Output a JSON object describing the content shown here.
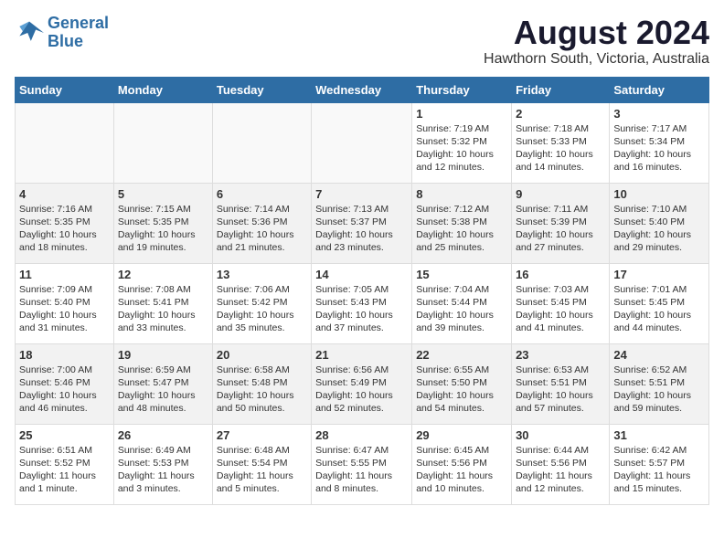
{
  "logo": {
    "line1": "General",
    "line2": "Blue"
  },
  "title": "August 2024",
  "location": "Hawthorn South, Victoria, Australia",
  "days_header": [
    "Sunday",
    "Monday",
    "Tuesday",
    "Wednesday",
    "Thursday",
    "Friday",
    "Saturday"
  ],
  "weeks": [
    [
      {
        "day": "",
        "info": ""
      },
      {
        "day": "",
        "info": ""
      },
      {
        "day": "",
        "info": ""
      },
      {
        "day": "",
        "info": ""
      },
      {
        "day": "1",
        "info": "Sunrise: 7:19 AM\nSunset: 5:32 PM\nDaylight: 10 hours\nand 12 minutes."
      },
      {
        "day": "2",
        "info": "Sunrise: 7:18 AM\nSunset: 5:33 PM\nDaylight: 10 hours\nand 14 minutes."
      },
      {
        "day": "3",
        "info": "Sunrise: 7:17 AM\nSunset: 5:34 PM\nDaylight: 10 hours\nand 16 minutes."
      }
    ],
    [
      {
        "day": "4",
        "info": "Sunrise: 7:16 AM\nSunset: 5:35 PM\nDaylight: 10 hours\nand 18 minutes."
      },
      {
        "day": "5",
        "info": "Sunrise: 7:15 AM\nSunset: 5:35 PM\nDaylight: 10 hours\nand 19 minutes."
      },
      {
        "day": "6",
        "info": "Sunrise: 7:14 AM\nSunset: 5:36 PM\nDaylight: 10 hours\nand 21 minutes."
      },
      {
        "day": "7",
        "info": "Sunrise: 7:13 AM\nSunset: 5:37 PM\nDaylight: 10 hours\nand 23 minutes."
      },
      {
        "day": "8",
        "info": "Sunrise: 7:12 AM\nSunset: 5:38 PM\nDaylight: 10 hours\nand 25 minutes."
      },
      {
        "day": "9",
        "info": "Sunrise: 7:11 AM\nSunset: 5:39 PM\nDaylight: 10 hours\nand 27 minutes."
      },
      {
        "day": "10",
        "info": "Sunrise: 7:10 AM\nSunset: 5:40 PM\nDaylight: 10 hours\nand 29 minutes."
      }
    ],
    [
      {
        "day": "11",
        "info": "Sunrise: 7:09 AM\nSunset: 5:40 PM\nDaylight: 10 hours\nand 31 minutes."
      },
      {
        "day": "12",
        "info": "Sunrise: 7:08 AM\nSunset: 5:41 PM\nDaylight: 10 hours\nand 33 minutes."
      },
      {
        "day": "13",
        "info": "Sunrise: 7:06 AM\nSunset: 5:42 PM\nDaylight: 10 hours\nand 35 minutes."
      },
      {
        "day": "14",
        "info": "Sunrise: 7:05 AM\nSunset: 5:43 PM\nDaylight: 10 hours\nand 37 minutes."
      },
      {
        "day": "15",
        "info": "Sunrise: 7:04 AM\nSunset: 5:44 PM\nDaylight: 10 hours\nand 39 minutes."
      },
      {
        "day": "16",
        "info": "Sunrise: 7:03 AM\nSunset: 5:45 PM\nDaylight: 10 hours\nand 41 minutes."
      },
      {
        "day": "17",
        "info": "Sunrise: 7:01 AM\nSunset: 5:45 PM\nDaylight: 10 hours\nand 44 minutes."
      }
    ],
    [
      {
        "day": "18",
        "info": "Sunrise: 7:00 AM\nSunset: 5:46 PM\nDaylight: 10 hours\nand 46 minutes."
      },
      {
        "day": "19",
        "info": "Sunrise: 6:59 AM\nSunset: 5:47 PM\nDaylight: 10 hours\nand 48 minutes."
      },
      {
        "day": "20",
        "info": "Sunrise: 6:58 AM\nSunset: 5:48 PM\nDaylight: 10 hours\nand 50 minutes."
      },
      {
        "day": "21",
        "info": "Sunrise: 6:56 AM\nSunset: 5:49 PM\nDaylight: 10 hours\nand 52 minutes."
      },
      {
        "day": "22",
        "info": "Sunrise: 6:55 AM\nSunset: 5:50 PM\nDaylight: 10 hours\nand 54 minutes."
      },
      {
        "day": "23",
        "info": "Sunrise: 6:53 AM\nSunset: 5:51 PM\nDaylight: 10 hours\nand 57 minutes."
      },
      {
        "day": "24",
        "info": "Sunrise: 6:52 AM\nSunset: 5:51 PM\nDaylight: 10 hours\nand 59 minutes."
      }
    ],
    [
      {
        "day": "25",
        "info": "Sunrise: 6:51 AM\nSunset: 5:52 PM\nDaylight: 11 hours\nand 1 minute."
      },
      {
        "day": "26",
        "info": "Sunrise: 6:49 AM\nSunset: 5:53 PM\nDaylight: 11 hours\nand 3 minutes."
      },
      {
        "day": "27",
        "info": "Sunrise: 6:48 AM\nSunset: 5:54 PM\nDaylight: 11 hours\nand 5 minutes."
      },
      {
        "day": "28",
        "info": "Sunrise: 6:47 AM\nSunset: 5:55 PM\nDaylight: 11 hours\nand 8 minutes."
      },
      {
        "day": "29",
        "info": "Sunrise: 6:45 AM\nSunset: 5:56 PM\nDaylight: 11 hours\nand 10 minutes."
      },
      {
        "day": "30",
        "info": "Sunrise: 6:44 AM\nSunset: 5:56 PM\nDaylight: 11 hours\nand 12 minutes."
      },
      {
        "day": "31",
        "info": "Sunrise: 6:42 AM\nSunset: 5:57 PM\nDaylight: 11 hours\nand 15 minutes."
      }
    ]
  ]
}
